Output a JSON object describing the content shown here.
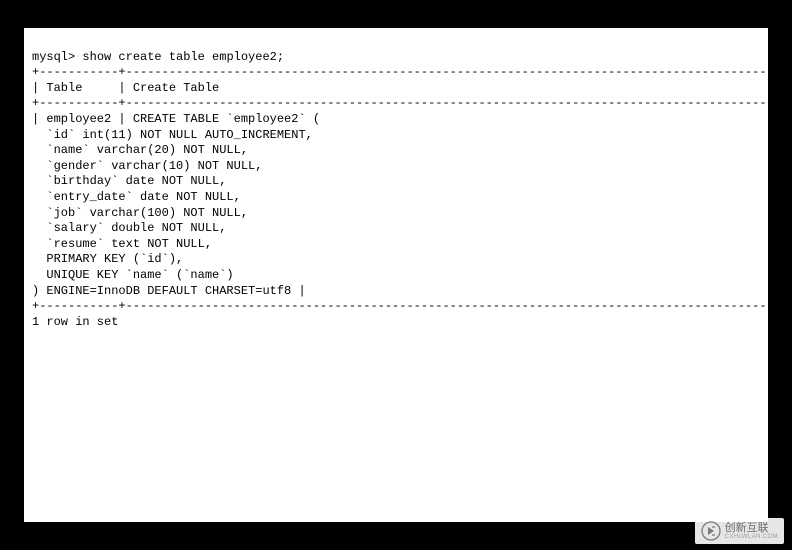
{
  "terminal": {
    "prompt": "mysql>",
    "command": "show create table employee2;",
    "border_top": "+-----------+-------------------------------------------------------------------------------------------------------------------------------------------------------------------------------------------------------------------------------------------------------------------------------------------------------------------------------------+",
    "header_row": "| Table     | Create Table                                                                                                                                                                                                                                                                                                                                           |",
    "data_table": "| employee2 | CREATE TABLE `employee2` (",
    "col_id": "  `id` int(11) NOT NULL AUTO_INCREMENT,",
    "col_name": "  `name` varchar(20) NOT NULL,",
    "col_gender": "  `gender` varchar(10) NOT NULL,",
    "col_birthday": "  `birthday` date NOT NULL,",
    "col_entry_date": "  `entry_date` date NOT NULL,",
    "col_job": "  `job` varchar(100) NOT NULL,",
    "col_salary": "  `salary` double NOT NULL,",
    "col_resume": "  `resume` text NOT NULL,",
    "pk": "  PRIMARY KEY (`id`),",
    "uk": "  UNIQUE KEY `name` (`name`)",
    "engine": ") ENGINE=InnoDB DEFAULT CHARSET=utf8 |",
    "border_bottom": "+-----------+-------------------------------------------------------------------------------------------------------------------------------------------------------------------------------------------------------------------------------------------------------------------------------------------------------------------------------------+",
    "result": "1 row in set"
  },
  "watermark": {
    "name": "创新互联",
    "sub": "CXHLWLAN.COM"
  }
}
